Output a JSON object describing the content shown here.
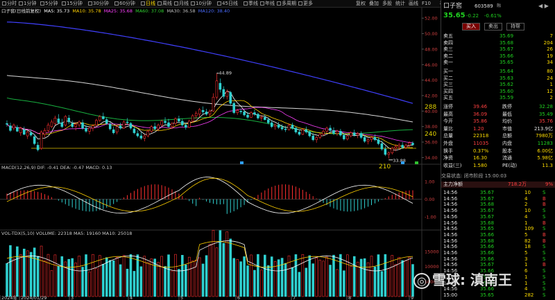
{
  "toolbar": {
    "left": [
      "分时",
      "1分钟",
      "5分钟",
      "15分钟",
      "30分钟",
      "60分钟",
      "日线",
      "周线",
      "月线",
      "10分钟",
      "45日线",
      "季线",
      "年线",
      "多周期",
      "更多"
    ],
    "selected": "日线",
    "right": [
      "复权",
      "叠加",
      "多股",
      "统计",
      "画线",
      "F10",
      "标记"
    ]
  },
  "ma_legend": {
    "name": "口子窖(日线前复权)",
    "ma5": "MA5: 35.73",
    "ma10": "MA10: 35.78",
    "ma25": "MA25: 35.68",
    "ma60": "MA60: 37.08",
    "ma30": "MA30: 36.58",
    "ma120": "MA120: 38.40"
  },
  "price_axis": [
    "52.00",
    "50.00",
    "48.00",
    "46.00",
    "44.00",
    "42.00",
    "40.00",
    "38.00",
    "36.00",
    "34.00"
  ],
  "annotations": {
    "high": "44.89",
    "low": "33.88",
    "lv288": "288",
    "lv240": "240",
    "lv210": "210"
  },
  "macd": {
    "legend": "MACD(12,26,9) DIF: -0.41  DEA: -0.47  MACD: 0.13",
    "axis": [
      "1.00",
      "0.00",
      "-1.00"
    ]
  },
  "volume": {
    "legend": "VOL-TDX(5,10) VOLUME: 22318  MA5: 19160  MA10: 25018",
    "axis": [
      "15000",
      "10000",
      "5000"
    ]
  },
  "date_axis": [
    "2024年",
    "2024/01/29",
    "3",
    "4",
    "5",
    "6",
    "7",
    "8",
    "9"
  ],
  "quote": {
    "name": "口子窖",
    "code": "603589",
    "tag": "融",
    "price": "35.65",
    "change": "-0.22",
    "pct": "-0.61%",
    "buttons": [
      "买入",
      "卖出",
      "持帮"
    ],
    "asks": [
      {
        "label": "卖五",
        "price": "35.69",
        "vol": "7"
      },
      {
        "label": "卖四",
        "price": "35.68",
        "vol": "204"
      },
      {
        "label": "卖三",
        "price": "35.67",
        "vol": "26"
      },
      {
        "label": "卖二",
        "price": "35.66",
        "vol": "19"
      },
      {
        "label": "卖一",
        "price": "35.65",
        "vol": "34"
      }
    ],
    "bids": [
      {
        "label": "买一",
        "price": "35.64",
        "vol": "80"
      },
      {
        "label": "买二",
        "price": "35.63",
        "vol": "24"
      },
      {
        "label": "买三",
        "price": "35.62",
        "vol": "1"
      },
      {
        "label": "买四",
        "price": "35.60",
        "vol": "12"
      },
      {
        "label": "买五",
        "price": "35.59",
        "vol": "2"
      }
    ],
    "stats": [
      [
        "涨停",
        "39.46",
        "跌停",
        "32.28"
      ],
      [
        "最高",
        "36.09",
        "最低",
        "35.49"
      ],
      [
        "今开",
        "35.86",
        "均价",
        "35.76"
      ],
      [
        "量比",
        "1.20",
        "市值",
        "213.9亿"
      ],
      [
        "总量",
        "22318",
        "总额",
        "7980万"
      ],
      [
        "外盘",
        "11035",
        "内盘",
        "11283"
      ],
      [
        "换手",
        "0.37%",
        "股本",
        "6.00亿"
      ],
      [
        "净资",
        "16.30",
        "流通",
        "5.98亿"
      ],
      [
        "收益(三)",
        "1.580",
        "PE(动)",
        "11.3"
      ]
    ],
    "status": "交易状态: 闭市阶段 15:00:03",
    "flow_label": "主力净额",
    "flow_value": "718.2万",
    "flow_pct": "9%",
    "ticks": [
      [
        "14:56",
        "35.67",
        "10",
        "S"
      ],
      [
        "14:56",
        "35.67",
        "4",
        "B"
      ],
      [
        "14:56",
        "35.68",
        "2",
        "B"
      ],
      [
        "14:56",
        "35.67",
        "10",
        "S"
      ],
      [
        "14:56",
        "35.67",
        "4",
        "S"
      ],
      [
        "14:56",
        "35.68",
        "1",
        "B"
      ],
      [
        "14:56",
        "35.65",
        "109",
        "S"
      ],
      [
        "14:56",
        "35.66",
        "5",
        "B"
      ],
      [
        "14:56",
        "35.68",
        "82",
        "B"
      ],
      [
        "14:56",
        "35.66",
        "18",
        "S"
      ],
      [
        "14:56",
        "35.66",
        "5",
        "S"
      ],
      [
        "14:56",
        "35.66",
        "3",
        "S"
      ],
      [
        "14:56",
        "35.67",
        "1",
        "B"
      ],
      [
        "14:56",
        "35.66",
        "6",
        "S"
      ],
      [
        "14:56",
        "35.66",
        "1",
        "S"
      ],
      [
        "14:56",
        "35.66",
        "1",
        "S"
      ],
      [
        "14:56",
        "35.66",
        "4",
        "S"
      ],
      [
        "15:00",
        "35.65",
        "282",
        "S"
      ]
    ]
  },
  "watermark": "雪球: 滇南王",
  "chart_data": {
    "type": "candlestick",
    "price_ylim": [
      33.5,
      53
    ],
    "ohlc": [
      [
        38.4,
        38.8,
        38.0,
        38.3
      ],
      [
        38.1,
        38.5,
        37.3,
        37.5
      ],
      [
        37.8,
        38.4,
        37.5,
        38.2
      ],
      [
        37.9,
        38.2,
        37.3,
        37.4
      ],
      [
        37.2,
        38.0,
        36.8,
        37.8
      ],
      [
        37.6,
        38.0,
        36.9,
        37.0
      ],
      [
        36.8,
        37.5,
        36.4,
        37.3
      ],
      [
        37.2,
        37.6,
        36.7,
        36.9
      ],
      [
        36.7,
        37.0,
        35.6,
        35.8
      ],
      [
        35.6,
        36.0,
        34.8,
        35.0
      ],
      [
        35.2,
        37.5,
        35.0,
        37.3
      ],
      [
        37.0,
        37.8,
        36.6,
        37.5
      ],
      [
        37.5,
        38.5,
        37.2,
        38.2
      ],
      [
        38.0,
        38.9,
        37.8,
        38.6
      ],
      [
        38.4,
        39.4,
        38.2,
        39.1
      ],
      [
        39.0,
        39.6,
        38.3,
        38.5
      ],
      [
        38.5,
        39.0,
        37.8,
        38.0
      ],
      [
        38.2,
        39.5,
        38.0,
        39.3
      ],
      [
        39.1,
        39.5,
        38.3,
        38.6
      ],
      [
        38.4,
        38.8,
        37.8,
        38.0
      ],
      [
        38.0,
        38.6,
        37.5,
        38.3
      ],
      [
        38.2,
        38.8,
        37.9,
        38.6
      ],
      [
        38.5,
        38.9,
        37.6,
        37.8
      ],
      [
        37.8,
        38.2,
        37.2,
        37.4
      ],
      [
        37.4,
        38.0,
        37.0,
        37.8
      ],
      [
        37.8,
        38.3,
        37.4,
        38.1
      ],
      [
        38.2,
        39.0,
        38.0,
        38.8
      ],
      [
        38.8,
        39.5,
        38.6,
        39.3
      ],
      [
        39.3,
        39.8,
        38.9,
        39.0
      ],
      [
        38.9,
        39.2,
        38.2,
        38.4
      ],
      [
        38.3,
        38.6,
        37.5,
        37.7
      ],
      [
        37.6,
        38.0,
        37.0,
        37.2
      ],
      [
        37.3,
        38.2,
        37.0,
        38.0
      ],
      [
        38.1,
        38.5,
        37.6,
        37.8
      ],
      [
        37.8,
        38.8,
        37.7,
        38.6
      ],
      [
        38.6,
        39.1,
        38.2,
        38.5
      ],
      [
        38.4,
        38.6,
        37.6,
        37.8
      ],
      [
        37.7,
        38.0,
        37.0,
        37.2
      ],
      [
        37.1,
        37.5,
        36.6,
        36.8
      ],
      [
        36.8,
        37.3,
        36.3,
        36.5
      ],
      [
        36.5,
        37.0,
        36.1,
        36.8
      ],
      [
        36.8,
        37.6,
        36.6,
        37.4
      ],
      [
        37.4,
        38.2,
        37.2,
        38.0
      ],
      [
        38.0,
        38.5,
        37.5,
        37.7
      ],
      [
        37.7,
        38.4,
        37.4,
        38.2
      ],
      [
        38.2,
        38.9,
        38.0,
        38.7
      ],
      [
        38.7,
        39.2,
        38.3,
        38.5
      ],
      [
        38.5,
        39.0,
        37.8,
        38.0
      ],
      [
        38.0,
        38.6,
        37.7,
        38.4
      ],
      [
        38.4,
        39.2,
        38.2,
        39.0
      ],
      [
        39.0,
        39.4,
        38.5,
        38.7
      ],
      [
        38.7,
        39.0,
        38.0,
        38.2
      ],
      [
        38.2,
        38.5,
        37.6,
        37.9
      ],
      [
        37.9,
        38.9,
        37.8,
        38.7
      ],
      [
        38.7,
        39.6,
        38.5,
        39.4
      ],
      [
        39.4,
        40.0,
        39.0,
        39.7
      ],
      [
        39.6,
        40.4,
        39.2,
        40.2
      ],
      [
        40.1,
        40.6,
        39.6,
        39.9
      ],
      [
        39.9,
        40.3,
        39.4,
        39.6
      ],
      [
        39.6,
        40.2,
        39.3,
        40.0
      ],
      [
        40.0,
        42.3,
        39.9,
        41.8
      ],
      [
        41.8,
        44.89,
        41.5,
        43.9
      ],
      [
        43.6,
        44.2,
        42.4,
        42.8
      ],
      [
        42.8,
        43.2,
        41.6,
        41.9
      ],
      [
        41.9,
        42.8,
        41.5,
        42.5
      ],
      [
        42.4,
        42.6,
        40.8,
        41.0
      ],
      [
        41.0,
        41.2,
        39.6,
        39.8
      ],
      [
        39.8,
        40.3,
        39.5,
        40.1
      ],
      [
        40.0,
        40.3,
        39.6,
        39.9
      ],
      [
        39.9,
        40.2,
        39.3,
        39.5
      ],
      [
        39.5,
        39.9,
        39.0,
        39.2
      ],
      [
        39.2,
        40.0,
        39.1,
        39.8
      ],
      [
        39.8,
        40.2,
        39.4,
        39.6
      ],
      [
        39.6,
        39.8,
        38.9,
        39.1
      ],
      [
        39.1,
        39.5,
        38.7,
        39.2
      ],
      [
        39.2,
        39.6,
        38.8,
        38.9
      ],
      [
        38.9,
        39.2,
        38.3,
        38.5
      ],
      [
        38.5,
        38.8,
        37.8,
        38.0
      ],
      [
        38.0,
        38.4,
        37.6,
        38.2
      ],
      [
        38.2,
        38.6,
        37.7,
        37.9
      ],
      [
        37.9,
        38.3,
        37.5,
        37.7
      ],
      [
        37.7,
        38.1,
        37.3,
        37.6
      ],
      [
        37.6,
        38.4,
        37.5,
        38.2
      ],
      [
        38.2,
        38.5,
        37.6,
        37.8
      ],
      [
        37.8,
        38.0,
        37.1,
        37.3
      ],
      [
        37.3,
        37.6,
        36.8,
        37.0
      ],
      [
        37.0,
        37.8,
        36.9,
        37.6
      ],
      [
        37.6,
        38.0,
        37.1,
        37.3
      ],
      [
        37.3,
        37.5,
        36.6,
        36.8
      ],
      [
        36.8,
        37.2,
        36.1,
        36.3
      ],
      [
        36.3,
        36.8,
        35.9,
        36.6
      ],
      [
        36.6,
        37.2,
        36.4,
        37.0
      ],
      [
        37.0,
        37.6,
        36.8,
        37.4
      ],
      [
        37.4,
        38.0,
        37.1,
        37.8
      ],
      [
        37.8,
        38.2,
        37.3,
        37.5
      ],
      [
        37.5,
        37.9,
        36.9,
        37.1
      ],
      [
        37.1,
        37.6,
        36.8,
        37.4
      ],
      [
        37.4,
        37.7,
        36.7,
        36.9
      ],
      [
        36.9,
        37.2,
        36.2,
        36.4
      ],
      [
        36.4,
        37.0,
        36.2,
        36.8
      ],
      [
        36.8,
        37.4,
        36.6,
        37.2
      ],
      [
        37.2,
        37.6,
        36.7,
        36.9
      ],
      [
        36.9,
        37.3,
        36.5,
        37.1
      ],
      [
        37.1,
        37.4,
        36.4,
        36.6
      ],
      [
        36.6,
        36.9,
        35.9,
        36.1
      ],
      [
        36.1,
        36.5,
        35.7,
        36.3
      ],
      [
        36.3,
        36.8,
        36.0,
        36.6
      ],
      [
        36.6,
        37.0,
        36.1,
        36.3
      ],
      [
        36.3,
        36.6,
        35.6,
        35.8
      ],
      [
        35.8,
        36.2,
        34.9,
        35.1
      ],
      [
        35.1,
        35.5,
        34.2,
        34.4
      ],
      [
        34.4,
        34.8,
        33.88,
        34.6
      ],
      [
        34.6,
        35.4,
        34.4,
        35.2
      ],
      [
        35.2,
        35.7,
        34.8,
        35.4
      ],
      [
        35.4,
        35.9,
        35.0,
        35.6
      ],
      [
        35.6,
        36.0,
        35.1,
        35.3
      ],
      [
        35.3,
        35.8,
        35.1,
        35.6
      ],
      [
        35.6,
        36.1,
        35.3,
        35.9
      ],
      [
        35.86,
        36.09,
        35.49,
        35.65
      ]
    ],
    "ma_lines": [
      {
        "name": "MA60",
        "color": "#1a8fe8",
        "from": 53.2,
        "to": 38.8
      },
      {
        "name": "MA30",
        "color": "#d8d8d8",
        "from": 44.6,
        "to": 38.6
      },
      {
        "name": "MA25",
        "color": "#18b040",
        "from": 41.2,
        "to": 37.1
      },
      {
        "name": "MA120",
        "color": "#4040ff",
        "from": 51.5,
        "to": 41.0
      }
    ],
    "macd_ylim": [
      -1.6,
      1.6
    ],
    "vol_ylim": [
      0,
      20000
    ]
  }
}
